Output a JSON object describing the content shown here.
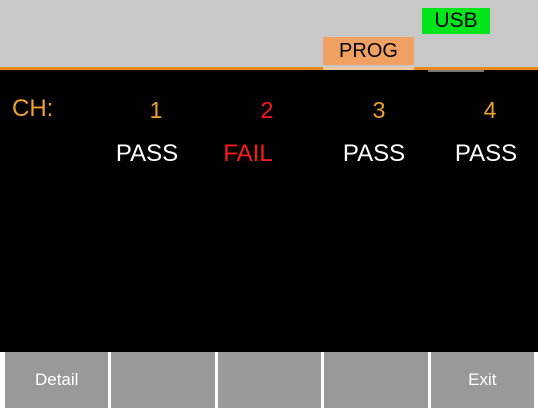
{
  "status": {
    "usb_label": "USB",
    "mode_label": "PROG",
    "usb_color": "#00e61a",
    "mode_color": "#f0a060"
  },
  "results": {
    "channel_label": "CH:",
    "channels": [
      {
        "number": "1",
        "result": "PASS",
        "number_color": "#f0a030",
        "result_color": "#ffffff"
      },
      {
        "number": "2",
        "result": "FAIL",
        "number_color": "#ff1a1a",
        "result_color": "#ff1a1a"
      },
      {
        "number": "3",
        "result": "PASS",
        "number_color": "#f0a030",
        "result_color": "#ffffff"
      },
      {
        "number": "4",
        "result": "PASS",
        "number_color": "#f0a030",
        "result_color": "#ffffff"
      }
    ]
  },
  "softkeys": [
    {
      "label": "Detail"
    },
    {
      "label": ""
    },
    {
      "label": ""
    },
    {
      "label": ""
    },
    {
      "label": "Exit"
    }
  ],
  "theme": {
    "header_bg": "#c8c8c8",
    "accent": "#e8891e",
    "panel_bg": "#000000",
    "softkey_bg": "#999999"
  }
}
